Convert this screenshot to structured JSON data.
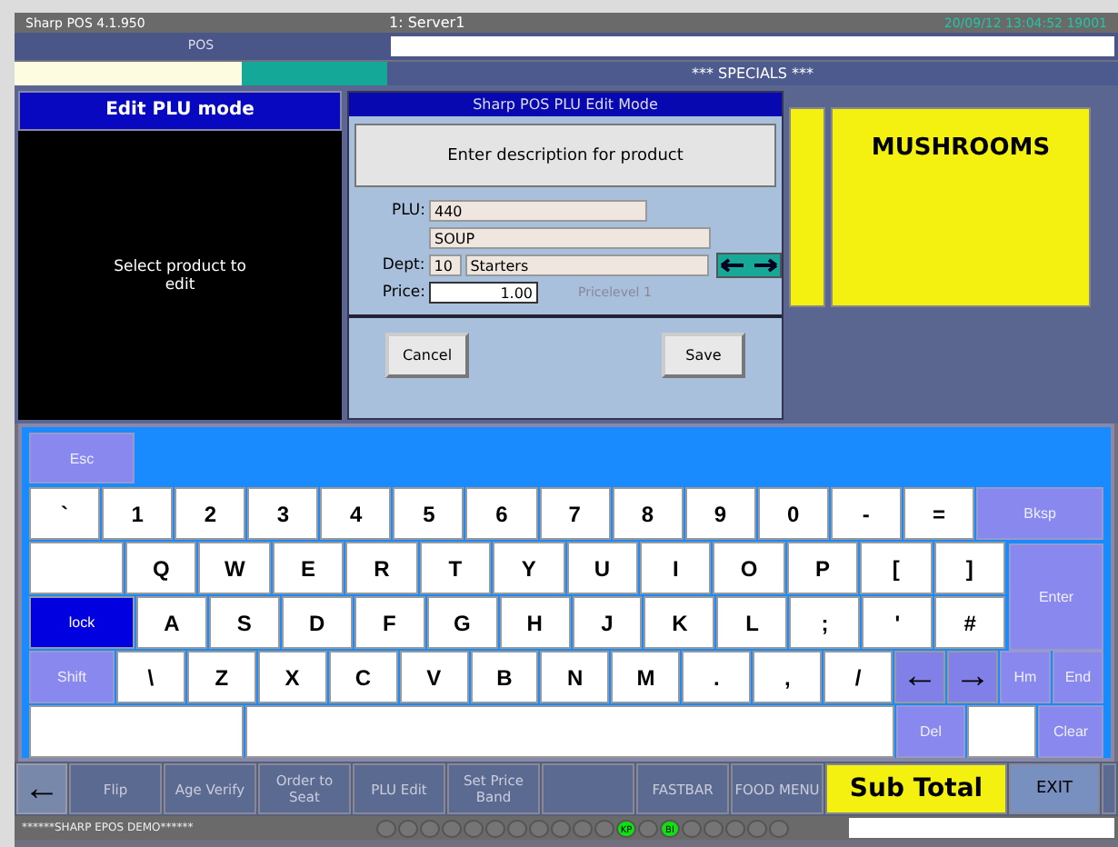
{
  "header": {
    "app_version": "Sharp POS 4.1.950",
    "mode": "POS",
    "server": "1: Server1",
    "clock": "20/09/12 13:04:52 19001"
  },
  "category_tabs": [
    {
      "color": "#fdfbe0"
    },
    {
      "color": "#14a898"
    },
    {
      "label": "*** SPECIALS ***",
      "color": "#4c5a8e"
    }
  ],
  "left_panel": {
    "title": "Edit PLU mode",
    "message": "Select product to edit"
  },
  "dialog": {
    "title": "Sharp POS PLU Edit Mode",
    "prompt": "Enter description for product",
    "plu_label": "PLU:",
    "plu": "440",
    "description": "SOUP",
    "dept_label": "Dept:",
    "dept_number": "10",
    "dept_name": "Starters",
    "price_label": "Price:",
    "price": "1.00",
    "price_level": "Pricelevel 1",
    "buttons": [
      "Cancel",
      "Save"
    ]
  },
  "products": [
    {
      "kind": "blank"
    },
    {
      "kind": "named",
      "label": "MUSHROOMS"
    }
  ],
  "keyboard": {
    "escape": "Esc",
    "rows": [
      {
        "keys": [
          {
            "kind": "char",
            "label": "`"
          },
          {
            "kind": "char",
            "label": "1"
          },
          {
            "kind": "char",
            "label": "2"
          },
          {
            "kind": "char",
            "label": "3"
          },
          {
            "kind": "char",
            "label": "4"
          },
          {
            "kind": "char",
            "label": "5"
          },
          {
            "kind": "char",
            "label": "6"
          },
          {
            "kind": "char",
            "label": "7"
          },
          {
            "kind": "char",
            "label": "8"
          },
          {
            "kind": "char",
            "label": "9"
          },
          {
            "kind": "char",
            "label": "0"
          },
          {
            "kind": "char",
            "label": "-"
          },
          {
            "kind": "char",
            "label": "="
          },
          {
            "kind": "func",
            "label": "Bksp"
          }
        ]
      },
      {
        "keys": [
          {
            "kind": "blank"
          },
          {
            "kind": "char",
            "label": "Q"
          },
          {
            "kind": "char",
            "label": "W"
          },
          {
            "kind": "char",
            "label": "E"
          },
          {
            "kind": "char",
            "label": "R"
          },
          {
            "kind": "char",
            "label": "T"
          },
          {
            "kind": "char",
            "label": "Y"
          },
          {
            "kind": "char",
            "label": "U"
          },
          {
            "kind": "char",
            "label": "I"
          },
          {
            "kind": "char",
            "label": "O"
          },
          {
            "kind": "char",
            "label": "P"
          },
          {
            "kind": "char",
            "label": "["
          },
          {
            "kind": "char",
            "label": "]"
          }
        ]
      },
      {
        "keys": [
          {
            "kind": "toggle",
            "label": "lock",
            "on": true
          },
          {
            "kind": "char",
            "label": "A"
          },
          {
            "kind": "char",
            "label": "S"
          },
          {
            "kind": "char",
            "label": "D"
          },
          {
            "kind": "char",
            "label": "F"
          },
          {
            "kind": "char",
            "label": "G"
          },
          {
            "kind": "char",
            "label": "H"
          },
          {
            "kind": "char",
            "label": "J"
          },
          {
            "kind": "char",
            "label": "K"
          },
          {
            "kind": "char",
            "label": "L"
          },
          {
            "kind": "char",
            "label": ";"
          },
          {
            "kind": "char",
            "label": "'"
          },
          {
            "kind": "char",
            "label": "#"
          }
        ]
      },
      {
        "keys": [
          {
            "kind": "func",
            "label": "Shift"
          },
          {
            "kind": "char",
            "label": "\\"
          },
          {
            "kind": "char",
            "label": "Z"
          },
          {
            "kind": "char",
            "label": "X"
          },
          {
            "kind": "char",
            "label": "C"
          },
          {
            "kind": "char",
            "label": "V"
          },
          {
            "kind": "char",
            "label": "B"
          },
          {
            "kind": "char",
            "label": "N"
          },
          {
            "kind": "char",
            "label": "M"
          },
          {
            "kind": "char",
            "label": "."
          },
          {
            "kind": "char",
            "label": ","
          },
          {
            "kind": "char",
            "label": "/"
          },
          {
            "kind": "arrow",
            "label": "←"
          },
          {
            "kind": "arrow",
            "label": "→"
          },
          {
            "kind": "func",
            "label": "Hm"
          },
          {
            "kind": "func",
            "label": "End"
          }
        ]
      },
      {
        "keys": [
          {
            "kind": "blank"
          },
          {
            "kind": "space"
          },
          {
            "kind": "func",
            "label": "Del"
          },
          {
            "kind": "blank"
          },
          {
            "kind": "func",
            "label": "Clear"
          }
        ]
      }
    ],
    "enter": "Enter"
  },
  "function_bar": {
    "back": "←",
    "buttons": [
      {
        "kind": "labelled",
        "label": "Flip"
      },
      {
        "kind": "labelled",
        "label": "Age Verify"
      },
      {
        "kind": "labelled",
        "label": "Order to Seat"
      },
      {
        "kind": "labelled",
        "label": "PLU Edit"
      },
      {
        "kind": "labelled",
        "label": "Set Price Band"
      },
      {
        "kind": "blank"
      },
      {
        "kind": "labelled",
        "label": "FASTBAR"
      },
      {
        "kind": "labelled",
        "label": "FOOD MENU"
      }
    ],
    "sub_total": "Sub Total",
    "exit": "EXIT"
  },
  "status_bar": {
    "message": "******SHARP EPOS DEMO******",
    "indicators": [
      {
        "on": false
      },
      {
        "on": false
      },
      {
        "on": false
      },
      {
        "on": false
      },
      {
        "on": false
      },
      {
        "on": false
      },
      {
        "on": false
      },
      {
        "on": false
      },
      {
        "on": false
      },
      {
        "on": false
      },
      {
        "on": false
      },
      {
        "on": true,
        "label": "KP"
      },
      {
        "on": false
      },
      {
        "on": true,
        "label": "BI"
      },
      {
        "on": false
      },
      {
        "on": false
      },
      {
        "on": false
      },
      {
        "on": false
      },
      {
        "on": false
      }
    ]
  }
}
